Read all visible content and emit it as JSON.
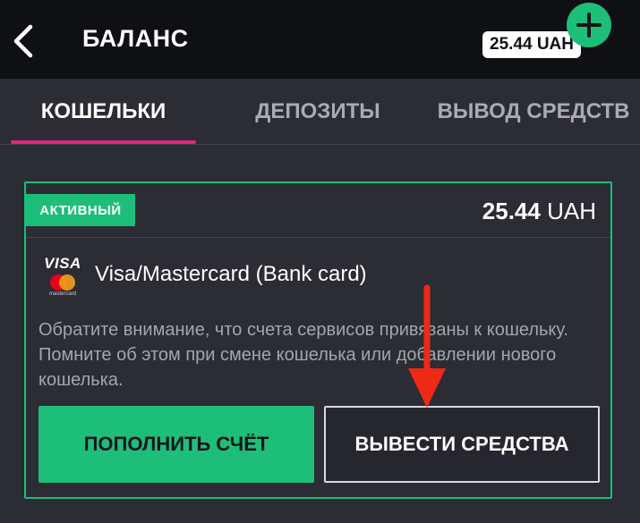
{
  "header": {
    "title": "БАЛАНС",
    "balance_badge": "25.44 UAH",
    "back_icon": "chevron-left-icon",
    "add_icon": "plus-icon"
  },
  "tabs": [
    {
      "label": "КОШЕЛЬКИ",
      "active": true
    },
    {
      "label": "ДЕПОЗИТЫ",
      "active": false
    },
    {
      "label": "ВЫВОД СРЕДСТВ",
      "active": false
    }
  ],
  "wallet": {
    "status_badge": "АКТИВНЫЙ",
    "amount_value": "25.44",
    "amount_currency": "UAH",
    "method_logo_text": "VISA",
    "mastercard_label": "mastercard",
    "method_name": "Visa/Mastercard (Bank card)",
    "notice": "Обратите внимание, что счета сервисов привязаны к кошельку. Помните об этом при смене кошелька или добавлении нового кошелька.",
    "deposit_button": "ПОПОЛНИТЬ СЧЁТ",
    "withdraw_button": "ВЫВЕСТИ СРЕДСТВА"
  },
  "colors": {
    "accent_green": "#1dbe7a",
    "tab_underline": "#e0277a",
    "header_bg": "#0f1014",
    "body_bg": "#2b2c34",
    "annotation_red": "#ee2a14"
  }
}
